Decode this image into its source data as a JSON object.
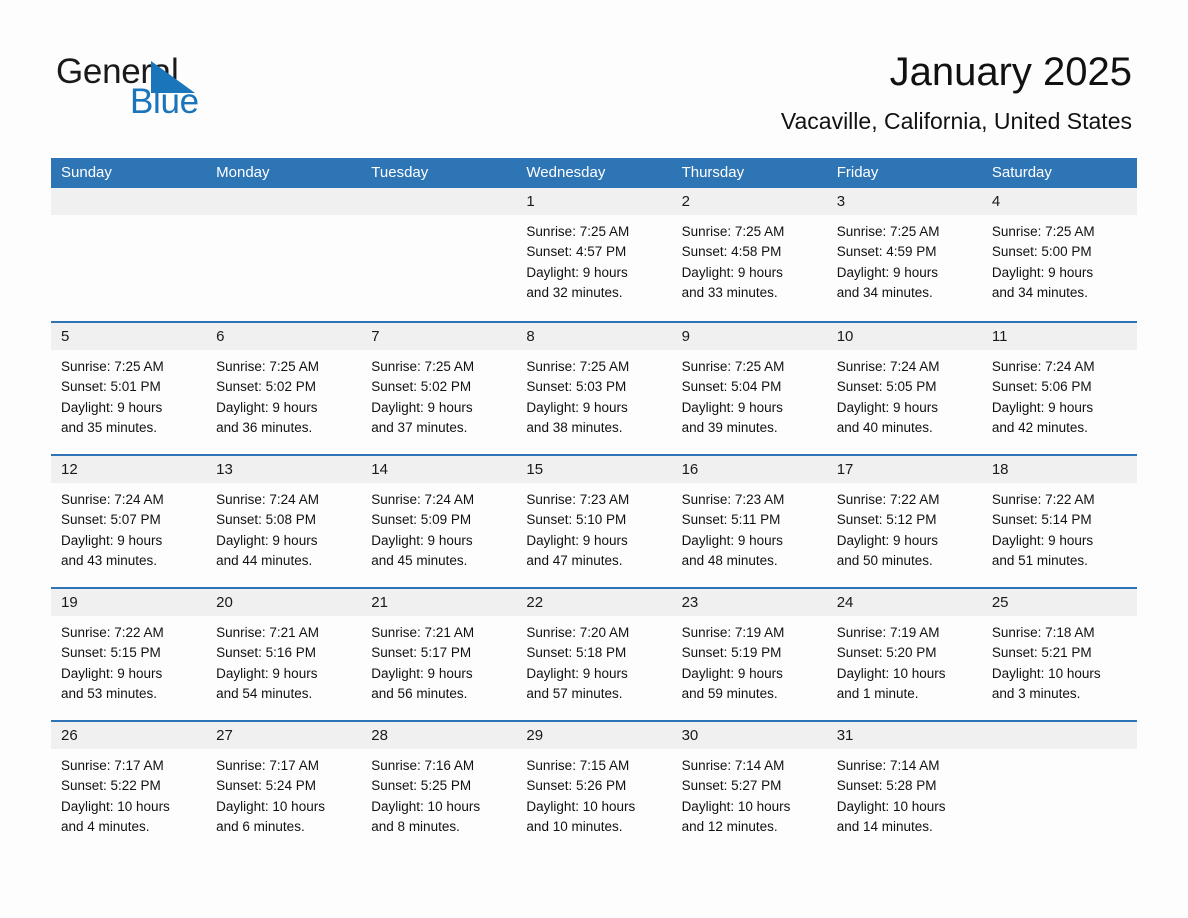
{
  "brand": {
    "name_part1": "General",
    "name_part2": "Blue",
    "accent_color": "#1b75bb"
  },
  "header": {
    "month_title": "January 2025",
    "location": "Vacaville, California, United States"
  },
  "calendar": {
    "header_color": "#2e75b6",
    "weekdays": [
      "Sunday",
      "Monday",
      "Tuesday",
      "Wednesday",
      "Thursday",
      "Friday",
      "Saturday"
    ],
    "weeks": [
      [
        {
          "empty": true
        },
        {
          "empty": true
        },
        {
          "empty": true
        },
        {
          "day": "1",
          "sunrise": "Sunrise: 7:25 AM",
          "sunset": "Sunset: 4:57 PM",
          "daylight1": "Daylight: 9 hours",
          "daylight2": "and 32 minutes."
        },
        {
          "day": "2",
          "sunrise": "Sunrise: 7:25 AM",
          "sunset": "Sunset: 4:58 PM",
          "daylight1": "Daylight: 9 hours",
          "daylight2": "and 33 minutes."
        },
        {
          "day": "3",
          "sunrise": "Sunrise: 7:25 AM",
          "sunset": "Sunset: 4:59 PM",
          "daylight1": "Daylight: 9 hours",
          "daylight2": "and 34 minutes."
        },
        {
          "day": "4",
          "sunrise": "Sunrise: 7:25 AM",
          "sunset": "Sunset: 5:00 PM",
          "daylight1": "Daylight: 9 hours",
          "daylight2": "and 34 minutes."
        }
      ],
      [
        {
          "day": "5",
          "sunrise": "Sunrise: 7:25 AM",
          "sunset": "Sunset: 5:01 PM",
          "daylight1": "Daylight: 9 hours",
          "daylight2": "and 35 minutes."
        },
        {
          "day": "6",
          "sunrise": "Sunrise: 7:25 AM",
          "sunset": "Sunset: 5:02 PM",
          "daylight1": "Daylight: 9 hours",
          "daylight2": "and 36 minutes."
        },
        {
          "day": "7",
          "sunrise": "Sunrise: 7:25 AM",
          "sunset": "Sunset: 5:02 PM",
          "daylight1": "Daylight: 9 hours",
          "daylight2": "and 37 minutes."
        },
        {
          "day": "8",
          "sunrise": "Sunrise: 7:25 AM",
          "sunset": "Sunset: 5:03 PM",
          "daylight1": "Daylight: 9 hours",
          "daylight2": "and 38 minutes."
        },
        {
          "day": "9",
          "sunrise": "Sunrise: 7:25 AM",
          "sunset": "Sunset: 5:04 PM",
          "daylight1": "Daylight: 9 hours",
          "daylight2": "and 39 minutes."
        },
        {
          "day": "10",
          "sunrise": "Sunrise: 7:24 AM",
          "sunset": "Sunset: 5:05 PM",
          "daylight1": "Daylight: 9 hours",
          "daylight2": "and 40 minutes."
        },
        {
          "day": "11",
          "sunrise": "Sunrise: 7:24 AM",
          "sunset": "Sunset: 5:06 PM",
          "daylight1": "Daylight: 9 hours",
          "daylight2": "and 42 minutes."
        }
      ],
      [
        {
          "day": "12",
          "sunrise": "Sunrise: 7:24 AM",
          "sunset": "Sunset: 5:07 PM",
          "daylight1": "Daylight: 9 hours",
          "daylight2": "and 43 minutes."
        },
        {
          "day": "13",
          "sunrise": "Sunrise: 7:24 AM",
          "sunset": "Sunset: 5:08 PM",
          "daylight1": "Daylight: 9 hours",
          "daylight2": "and 44 minutes."
        },
        {
          "day": "14",
          "sunrise": "Sunrise: 7:24 AM",
          "sunset": "Sunset: 5:09 PM",
          "daylight1": "Daylight: 9 hours",
          "daylight2": "and 45 minutes."
        },
        {
          "day": "15",
          "sunrise": "Sunrise: 7:23 AM",
          "sunset": "Sunset: 5:10 PM",
          "daylight1": "Daylight: 9 hours",
          "daylight2": "and 47 minutes."
        },
        {
          "day": "16",
          "sunrise": "Sunrise: 7:23 AM",
          "sunset": "Sunset: 5:11 PM",
          "daylight1": "Daylight: 9 hours",
          "daylight2": "and 48 minutes."
        },
        {
          "day": "17",
          "sunrise": "Sunrise: 7:22 AM",
          "sunset": "Sunset: 5:12 PM",
          "daylight1": "Daylight: 9 hours",
          "daylight2": "and 50 minutes."
        },
        {
          "day": "18",
          "sunrise": "Sunrise: 7:22 AM",
          "sunset": "Sunset: 5:14 PM",
          "daylight1": "Daylight: 9 hours",
          "daylight2": "and 51 minutes."
        }
      ],
      [
        {
          "day": "19",
          "sunrise": "Sunrise: 7:22 AM",
          "sunset": "Sunset: 5:15 PM",
          "daylight1": "Daylight: 9 hours",
          "daylight2": "and 53 minutes."
        },
        {
          "day": "20",
          "sunrise": "Sunrise: 7:21 AM",
          "sunset": "Sunset: 5:16 PM",
          "daylight1": "Daylight: 9 hours",
          "daylight2": "and 54 minutes."
        },
        {
          "day": "21",
          "sunrise": "Sunrise: 7:21 AM",
          "sunset": "Sunset: 5:17 PM",
          "daylight1": "Daylight: 9 hours",
          "daylight2": "and 56 minutes."
        },
        {
          "day": "22",
          "sunrise": "Sunrise: 7:20 AM",
          "sunset": "Sunset: 5:18 PM",
          "daylight1": "Daylight: 9 hours",
          "daylight2": "and 57 minutes."
        },
        {
          "day": "23",
          "sunrise": "Sunrise: 7:19 AM",
          "sunset": "Sunset: 5:19 PM",
          "daylight1": "Daylight: 9 hours",
          "daylight2": "and 59 minutes."
        },
        {
          "day": "24",
          "sunrise": "Sunrise: 7:19 AM",
          "sunset": "Sunset: 5:20 PM",
          "daylight1": "Daylight: 10 hours",
          "daylight2": "and 1 minute."
        },
        {
          "day": "25",
          "sunrise": "Sunrise: 7:18 AM",
          "sunset": "Sunset: 5:21 PM",
          "daylight1": "Daylight: 10 hours",
          "daylight2": "and 3 minutes."
        }
      ],
      [
        {
          "day": "26",
          "sunrise": "Sunrise: 7:17 AM",
          "sunset": "Sunset: 5:22 PM",
          "daylight1": "Daylight: 10 hours",
          "daylight2": "and 4 minutes."
        },
        {
          "day": "27",
          "sunrise": "Sunrise: 7:17 AM",
          "sunset": "Sunset: 5:24 PM",
          "daylight1": "Daylight: 10 hours",
          "daylight2": "and 6 minutes."
        },
        {
          "day": "28",
          "sunrise": "Sunrise: 7:16 AM",
          "sunset": "Sunset: 5:25 PM",
          "daylight1": "Daylight: 10 hours",
          "daylight2": "and 8 minutes."
        },
        {
          "day": "29",
          "sunrise": "Sunrise: 7:15 AM",
          "sunset": "Sunset: 5:26 PM",
          "daylight1": "Daylight: 10 hours",
          "daylight2": "and 10 minutes."
        },
        {
          "day": "30",
          "sunrise": "Sunrise: 7:14 AM",
          "sunset": "Sunset: 5:27 PM",
          "daylight1": "Daylight: 10 hours",
          "daylight2": "and 12 minutes."
        },
        {
          "day": "31",
          "sunrise": "Sunrise: 7:14 AM",
          "sunset": "Sunset: 5:28 PM",
          "daylight1": "Daylight: 10 hours",
          "daylight2": "and 14 minutes."
        },
        {
          "empty": true
        }
      ]
    ]
  }
}
